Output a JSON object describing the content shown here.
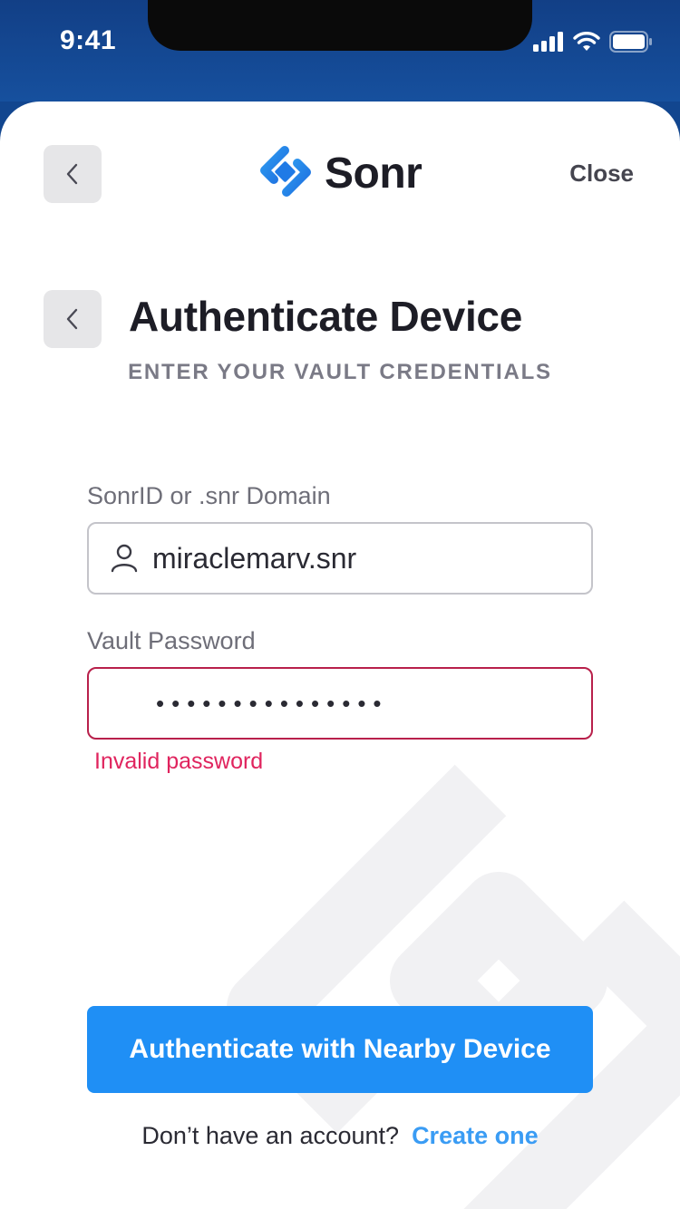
{
  "status_bar": {
    "time": "9:41"
  },
  "header": {
    "brand_name": "Sonr",
    "close_label": "Close"
  },
  "page": {
    "title": "Authenticate Device",
    "subtitle": "ENTER YOUR VAULT CREDENTIALS"
  },
  "form": {
    "sonrid": {
      "label": "SonrID or .snr Domain",
      "value": "miraclemarv.snr"
    },
    "password": {
      "label": "Vault Password",
      "masked_value": "•••••••••••••••",
      "error": "Invalid password"
    }
  },
  "actions": {
    "primary_label": "Authenticate with Nearby Device",
    "footer_text": "Don’t have an account?",
    "footer_link": "Create one"
  },
  "colors": {
    "status_bar_bg": "#16509e",
    "primary": "#1f8ff5",
    "error": "#e0245e",
    "link": "#3a9cf4"
  }
}
